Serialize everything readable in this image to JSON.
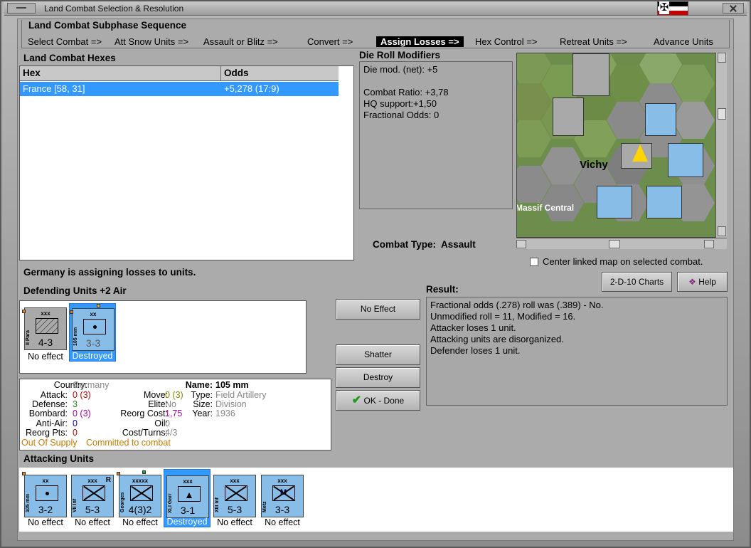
{
  "window": {
    "title": "Land Combat Selection & Resolution"
  },
  "subphase": {
    "title": "Land Combat Subphase Sequence",
    "steps": [
      "Select Combat =>",
      "Att Snow Units =>",
      "Assault or Blitz =>",
      "Convert =>",
      "Assign Losses =>",
      "Hex Control =>",
      "Retreat Units =>",
      "Advance Units"
    ],
    "active_index": 4
  },
  "hexes": {
    "title": "Land Combat Hexes",
    "col_hex": "Hex",
    "col_odds": "Odds",
    "rows": [
      {
        "hex": "France [58, 31]",
        "odds": "+5,278 (17:9)"
      }
    ]
  },
  "modifiers": {
    "title": "Die Roll Modifiers",
    "lines": [
      "Die mod. (net): +5",
      "",
      "Combat Ratio: +3,78",
      "HQ support:+1,50",
      "Fractional Odds: 0"
    ]
  },
  "combat_type": {
    "label": "Combat Type:",
    "value": "Assault"
  },
  "map": {
    "center_label": "Center linked map on selected combat.",
    "places": [
      "Vichy",
      "Massif Central"
    ]
  },
  "status_msg": "Germany is assigning losses to units.",
  "defending": {
    "title": "Defending Units +2 Air",
    "units": [
      {
        "side": "II Para",
        "size": "xxx",
        "str": "4-3",
        "result": "No effect",
        "type": "para",
        "color": "grey"
      },
      {
        "side": "105 mm",
        "size": "xx",
        "str": "3-3",
        "result": "Destroyed",
        "type": "art",
        "color": "blue",
        "selected": true
      }
    ]
  },
  "buttons": {
    "no_effect": "No Effect",
    "shatter": "Shatter",
    "destroy": "Destroy",
    "ok": "OK - Done",
    "charts": "2-D-10 Charts",
    "help": "Help"
  },
  "result": {
    "title": "Result:",
    "lines": [
      "Fractional odds (.278) roll was (.389)  - No.",
      "Unmodified roll = 11, Modified = 16.",
      "Attacker loses 1 unit.",
      "Attacking units are disorganized.",
      "Defender loses 1 unit."
    ]
  },
  "unit_info": {
    "country_label": "Country:",
    "country": "Germany",
    "attack_label": "Attack:",
    "attack": "0 (3)",
    "defense_label": "Defense:",
    "defense": "3",
    "bombard_label": "Bombard:",
    "bombard": "0 (3)",
    "antiair_label": "Anti-Air:",
    "antiair": "0",
    "reorg_label": "Reorg Pts:",
    "reorg": "0",
    "name_label": "Name:",
    "name": "105 mm",
    "move_label": "Move:",
    "move": "0 (3)",
    "type_label": "Type:",
    "type": "Field Artillery",
    "elite_label": "Elite:",
    "elite": "No",
    "size_label": "Size:",
    "size": "Division",
    "reorgcost_label": "Reorg Cost:",
    "reorgcost": "1,75",
    "year_label": "Year:",
    "year": "1936",
    "oil_label": "Oil:",
    "oil": "0",
    "costturns_label": "Cost/Turns:",
    "costturns": "4/3",
    "supply": "Out Of Supply",
    "committed": "Committed to combat"
  },
  "attacking": {
    "title": "Attacking Units",
    "units": [
      {
        "side": "105 mm",
        "size": "xx",
        "str": "3-2",
        "result": "No effect"
      },
      {
        "side": "VII Inf",
        "size": "xxx",
        "str": "5-3",
        "result": "No effect",
        "mark": "R"
      },
      {
        "side": "Georges",
        "size": "xxxxx",
        "str": "4(3)2",
        "result": "No effect"
      },
      {
        "side": "XLI Garr",
        "size": "xxx",
        "str": "3-1",
        "result": "Destroyed",
        "selected": true
      },
      {
        "side": "XIII Inf",
        "size": "xxx",
        "str": "5-3",
        "result": "No effect"
      },
      {
        "side": "Metz",
        "size": "xxx",
        "str": "3-3",
        "result": "No effect",
        "mark_inner": "M"
      }
    ]
  },
  "colors": {
    "accent": "#3399ff",
    "unit_blue": "#87bde6",
    "unit_grey": "#a9a9a9",
    "supply": "#cc7a00",
    "red_val": "#cc0000",
    "green_val": "#228822",
    "purple_val": "#aa00aa",
    "blue_val": "#0000cc"
  }
}
